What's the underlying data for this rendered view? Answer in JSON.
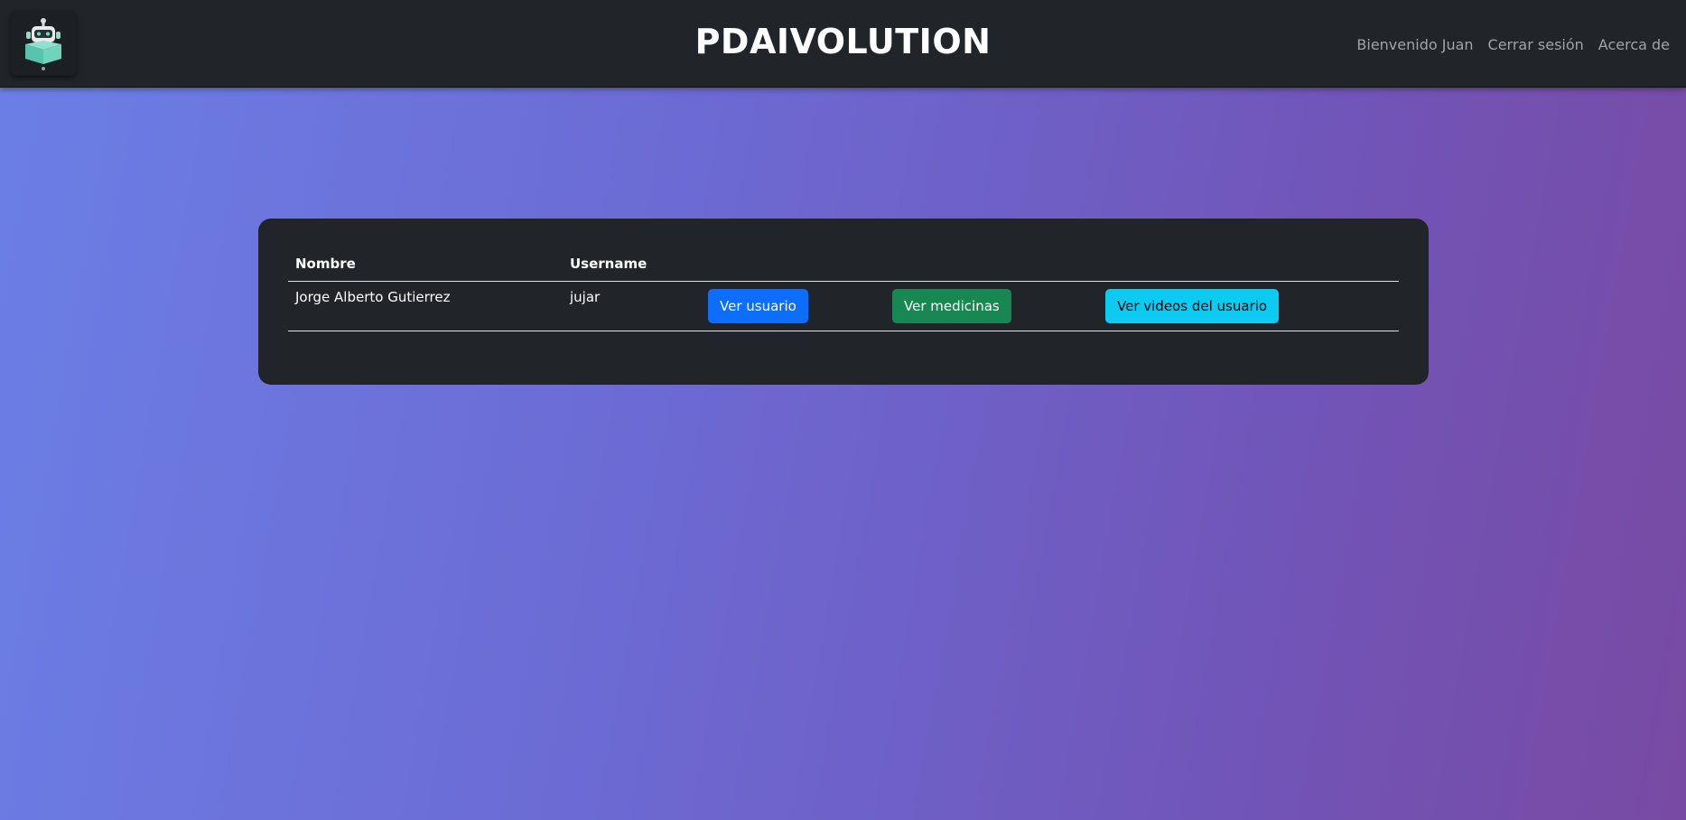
{
  "navbar": {
    "brand": "PDAIVOLUTION",
    "logo_icon": "robot-box-logo-icon",
    "links": [
      "Bienvenido Juan",
      "Cerrar sesión",
      "Acerca de"
    ]
  },
  "table": {
    "headers": [
      "Nombre",
      "Username",
      "",
      "",
      ""
    ],
    "rows": [
      {
        "nombre": "Jorge Alberto Gutierrez",
        "username": "jujar",
        "ver_usuario": "Ver usuario",
        "ver_medicinas": "Ver medicinas",
        "ver_videos": "Ver videos del usuario"
      }
    ]
  },
  "colors": {
    "navbar_bg": "#212529",
    "card_bg": "#212529",
    "btn_primary": "#0d6efd",
    "btn_success": "#198754",
    "btn_info": "#0dcaf0"
  }
}
